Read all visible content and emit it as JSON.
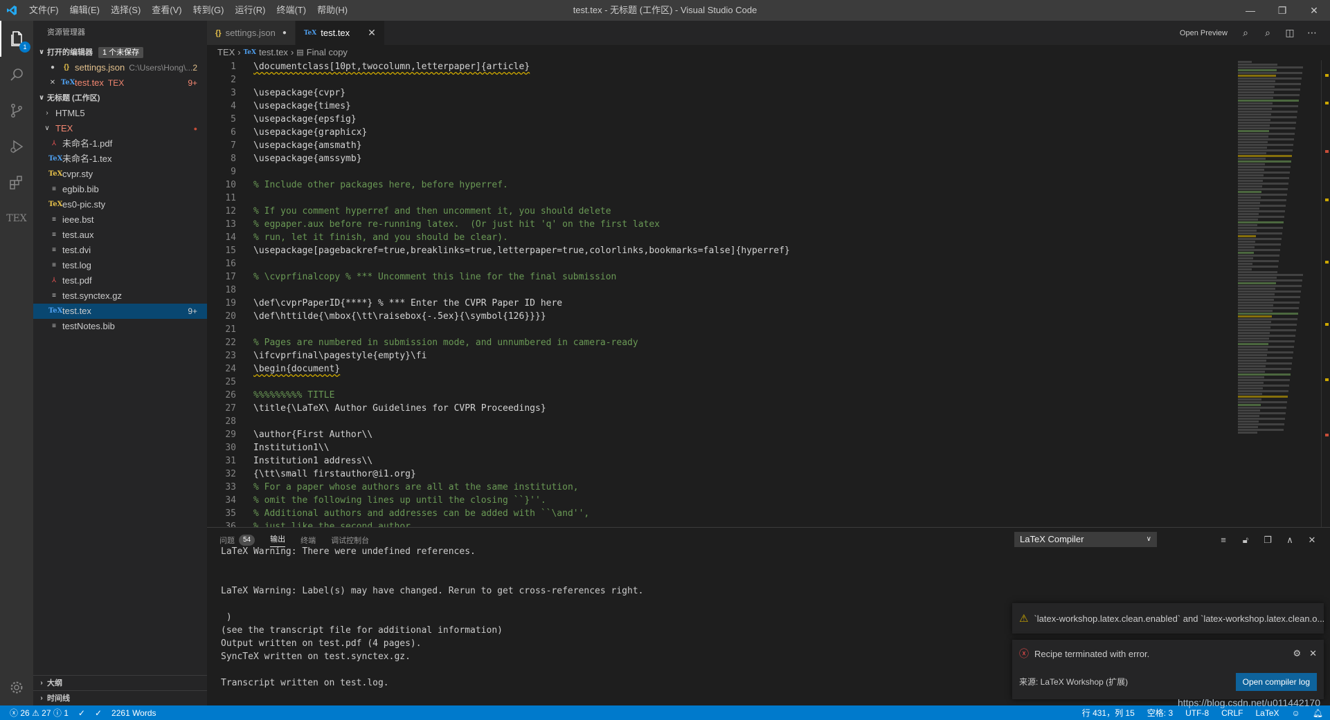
{
  "window": {
    "title": "test.tex - 无标题 (工作区) - Visual Studio Code",
    "menu": [
      "文件(F)",
      "编辑(E)",
      "选择(S)",
      "查看(V)",
      "转到(G)",
      "运行(R)",
      "终端(T)",
      "帮助(H)"
    ]
  },
  "activity": {
    "explorer_badge": "1",
    "tex_label": "TEX"
  },
  "sidebar": {
    "header": "资源管理器",
    "open_editors": {
      "title": "打开的编辑器",
      "badge": "1 个未保存",
      "items": [
        {
          "marker": "●",
          "name": "settings.json",
          "path": "C:\\Users\\Hong\\...",
          "count": "2"
        },
        {
          "marker": "✕",
          "name": "test.tex",
          "path": "TEX",
          "count": "9+"
        }
      ]
    },
    "workspace": {
      "title": "无标题 (工作区)",
      "folders": [
        "HTML5",
        "TEX"
      ],
      "files": [
        {
          "name": "未命名-1.pdf",
          "icon": "pdf"
        },
        {
          "name": "未命名-1.tex",
          "icon": "tex"
        },
        {
          "name": "cvpr.sty",
          "icon": "sty"
        },
        {
          "name": "egbib.bib",
          "icon": "lines"
        },
        {
          "name": "es0-pic.sty",
          "icon": "sty"
        },
        {
          "name": "ieee.bst",
          "icon": "lines"
        },
        {
          "name": "test.aux",
          "icon": "lines"
        },
        {
          "name": "test.dvi",
          "icon": "lines"
        },
        {
          "name": "test.log",
          "icon": "lines"
        },
        {
          "name": "test.pdf",
          "icon": "pdf"
        },
        {
          "name": "test.synctex.gz",
          "icon": "lines"
        },
        {
          "name": "test.tex",
          "icon": "tex",
          "count": "9+"
        },
        {
          "name": "testNotes.bib",
          "icon": "lines"
        }
      ]
    },
    "outline": "大纲",
    "timeline": "时间线"
  },
  "tabs": [
    {
      "label": "settings.json",
      "modified": "●"
    },
    {
      "label": "test.tex",
      "close": "✕"
    }
  ],
  "tab_actions": {
    "open_preview": "Open Preview"
  },
  "breadcrumb": {
    "folder": "TEX",
    "file": "test.tex",
    "symbol": "Final copy"
  },
  "code_lines": [
    {
      "n": "1",
      "t": "\\documentclass[10pt,twocolumn,letterpaper]{article}",
      "k": "squig"
    },
    {
      "n": "2",
      "t": "",
      "k": "cmd"
    },
    {
      "n": "3",
      "t": "\\usepackage{cvpr}",
      "k": "cmd"
    },
    {
      "n": "4",
      "t": "\\usepackage{times}",
      "k": "cmd"
    },
    {
      "n": "5",
      "t": "\\usepackage{epsfig}",
      "k": "cmd"
    },
    {
      "n": "6",
      "t": "\\usepackage{graphicx}",
      "k": "cmd"
    },
    {
      "n": "7",
      "t": "\\usepackage{amsmath}",
      "k": "cmd"
    },
    {
      "n": "8",
      "t": "\\usepackage{amssymb}",
      "k": "cmd"
    },
    {
      "n": "9",
      "t": "",
      "k": "cmd"
    },
    {
      "n": "10",
      "t": "% Include other packages here, before hyperref.",
      "k": "cmt"
    },
    {
      "n": "11",
      "t": "",
      "k": "cmd"
    },
    {
      "n": "12",
      "t": "% If you comment hyperref and then uncomment it, you should delete",
      "k": "cmt"
    },
    {
      "n": "13",
      "t": "% egpaper.aux before re-running latex.  (Or just hit 'q' on the first latex",
      "k": "cmt"
    },
    {
      "n": "14",
      "t": "% run, let it finish, and you should be clear).",
      "k": "cmt"
    },
    {
      "n": "15",
      "t": "\\usepackage[pagebackref=true,breaklinks=true,letterpaper=true,colorlinks,bookmarks=false]{hyperref}",
      "k": "cmd"
    },
    {
      "n": "16",
      "t": "",
      "k": "cmd"
    },
    {
      "n": "17",
      "t": "% \\cvprfinalcopy % *** Uncomment this line for the final submission",
      "k": "cmt"
    },
    {
      "n": "18",
      "t": "",
      "k": "cmd"
    },
    {
      "n": "19",
      "t": "\\def\\cvprPaperID{****} % *** Enter the CVPR Paper ID here",
      "k": "cmd"
    },
    {
      "n": "20",
      "t": "\\def\\httilde{\\mbox{\\tt\\raisebox{-.5ex}{\\symbol{126}}}}",
      "k": "cmd"
    },
    {
      "n": "21",
      "t": "",
      "k": "cmd"
    },
    {
      "n": "22",
      "t": "% Pages are numbered in submission mode, and unnumbered in camera-ready",
      "k": "cmt"
    },
    {
      "n": "23",
      "t": "\\ifcvprfinal\\pagestyle{empty}\\fi",
      "k": "cmd"
    },
    {
      "n": "24",
      "t": "\\begin{document}",
      "k": "squig"
    },
    {
      "n": "25",
      "t": "",
      "k": "cmd"
    },
    {
      "n": "26",
      "t": "%%%%%%%%% TITLE",
      "k": "cmt"
    },
    {
      "n": "27",
      "t": "\\title{\\LaTeX\\ Author Guidelines for CVPR Proceedings}",
      "k": "cmd"
    },
    {
      "n": "28",
      "t": "",
      "k": "cmd"
    },
    {
      "n": "29",
      "t": "\\author{First Author\\\\",
      "k": "cmd"
    },
    {
      "n": "30",
      "t": "Institution1\\\\",
      "k": "cmd"
    },
    {
      "n": "31",
      "t": "Institution1 address\\\\",
      "k": "cmd"
    },
    {
      "n": "32",
      "t": "{\\tt\\small firstauthor@i1.org}",
      "k": "cmd"
    },
    {
      "n": "33",
      "t": "% For a paper whose authors are all at the same institution,",
      "k": "cmt"
    },
    {
      "n": "34",
      "t": "% omit the following lines up until the closing ``}''.",
      "k": "cmt"
    },
    {
      "n": "35",
      "t": "% Additional authors and addresses can be added with ``\\and'',",
      "k": "cmt"
    },
    {
      "n": "36",
      "t": "% just like the second author.",
      "k": "cmt"
    }
  ],
  "panel": {
    "tabs": [
      {
        "label": "问题",
        "badge": "54"
      },
      {
        "label": "输出"
      },
      {
        "label": "终端"
      },
      {
        "label": "调试控制台"
      }
    ],
    "channel": "LaTeX Compiler",
    "output": [
      "LaTeX Warning: There were undefined references.",
      "",
      "",
      "LaTeX Warning: Label(s) may have changed. Rerun to get cross-references right.",
      "",
      " )",
      "(see the transcript file for additional information)",
      "Output written on test.pdf (4 pages).",
      "SyncTeX written on test.synctex.gz.",
      "",
      "Transcript written on test.log."
    ]
  },
  "notifications": {
    "warning": "`latex-workshop.latex.clean.enabled` and `latex-workshop.latex.clean.o...",
    "error": "Recipe terminated with error.",
    "source": "来源: LaTeX Workshop (扩展)",
    "button": "Open compiler log"
  },
  "statusbar": {
    "errors": "26",
    "warnings": "27",
    "infos": "1",
    "words": "2261 Words",
    "position": "行 431，列 15",
    "spaces": "空格: 3",
    "encoding": "UTF-8",
    "eol": "CRLF",
    "language": "LaTeX",
    "watermark": "https://blog.csdn.net/u011442170"
  }
}
